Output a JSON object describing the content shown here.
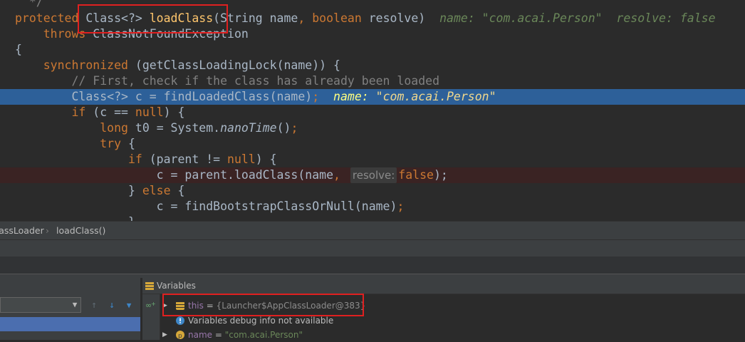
{
  "editor": {
    "lines": [
      {
        "parts": [
          {
            "t": "  */",
            "c": "cm"
          }
        ]
      },
      {
        "parts": [
          {
            "t": "protected ",
            "c": "kw"
          },
          {
            "t": "Class<?> ",
            "c": ""
          },
          {
            "t": "loadClass",
            "c": "fn"
          },
          {
            "t": "(String name",
            "c": ""
          },
          {
            "t": ", ",
            "c": "kw"
          },
          {
            "t": "boolean ",
            "c": "kw"
          },
          {
            "t": "resolve)  ",
            "c": ""
          },
          {
            "t": "name: \"com.acai.Person\"  resolve: false",
            "c": "inl"
          }
        ]
      },
      {
        "parts": [
          {
            "t": "    throws ",
            "c": "kw"
          },
          {
            "t": "ClassNotFoundException",
            "c": ""
          }
        ]
      },
      {
        "parts": [
          {
            "t": "{",
            "c": ""
          }
        ]
      },
      {
        "parts": [
          {
            "t": "    synchronized ",
            "c": "kw"
          },
          {
            "t": "(getClassLoadingLock(name)) {",
            "c": ""
          }
        ]
      },
      {
        "parts": [
          {
            "t": "        // First, check if the class has already been loaded",
            "c": "cm"
          }
        ]
      },
      {
        "hl": true,
        "parts": [
          {
            "t": "        Class<?> c = findLoadedClass(name)",
            "c": ""
          },
          {
            "t": ";  ",
            "c": "kw"
          },
          {
            "t": "name: ",
            "c": "inl-hl"
          },
          {
            "t": "\"com.acai.Person\"",
            "c": "inl-hl-v"
          }
        ]
      },
      {
        "parts": [
          {
            "t": "        if ",
            "c": "kw"
          },
          {
            "t": "(c == ",
            "c": ""
          },
          {
            "t": "null",
            "c": "kw"
          },
          {
            "t": ") {",
            "c": ""
          }
        ]
      },
      {
        "parts": [
          {
            "t": "            long ",
            "c": "kw"
          },
          {
            "t": "t0 = System.",
            "c": ""
          },
          {
            "t": "nanoTime",
            "c": "it"
          },
          {
            "t": "()",
            "c": ""
          },
          {
            "t": ";",
            "c": "kw"
          }
        ]
      },
      {
        "parts": [
          {
            "t": "            try ",
            "c": "kw"
          },
          {
            "t": "{",
            "c": ""
          }
        ]
      },
      {
        "parts": [
          {
            "t": "                if ",
            "c": "kw"
          },
          {
            "t": "(parent != ",
            "c": ""
          },
          {
            "t": "null",
            "c": "kw"
          },
          {
            "t": ") {",
            "c": ""
          }
        ]
      },
      {
        "err": true,
        "parts": [
          {
            "t": "                    c = parent.loadClass(name",
            "c": ""
          },
          {
            "t": ", ",
            "c": "kw"
          },
          {
            "t": "resolve:",
            "c": "badge"
          },
          {
            "t": "false",
            "c": "kw"
          },
          {
            "t": ");",
            "c": ""
          }
        ]
      },
      {
        "parts": [
          {
            "t": "                } ",
            "c": ""
          },
          {
            "t": "else ",
            "c": "kw"
          },
          {
            "t": "{",
            "c": ""
          }
        ]
      },
      {
        "parts": [
          {
            "t": "                    c = findBootstrapClassOrNull(name)",
            "c": ""
          },
          {
            "t": ";",
            "c": "kw"
          }
        ]
      },
      {
        "parts": [
          {
            "t": "                }",
            "c": ""
          }
        ]
      }
    ]
  },
  "breadcrumb": {
    "items": [
      "ClassLoader",
      "loadClass()"
    ],
    "separator": "›"
  },
  "variables_panel": {
    "title": "Variables",
    "rows": [
      {
        "expand": "▶",
        "icon": "field-icon",
        "icon_color": "#d6a83a",
        "name": "this",
        "equals": " = ",
        "value": "{Launcher$AppClassLoader@383}"
      },
      {
        "expand": "",
        "icon": "info-icon",
        "icon_color": "#3e86c7",
        "name": "",
        "equals": "",
        "value": "Variables debug info not available"
      },
      {
        "expand": "▶",
        "icon": "parameter-icon",
        "icon_color": "#d6a83a",
        "name": "name",
        "equals": " = ",
        "value": "\"com.acai.Person\""
      }
    ]
  },
  "frames_panel": {
    "dropdown_arrow": "▼",
    "toolbar": [
      {
        "name": "up-arrow-icon",
        "glyph": "↑",
        "color": "#5f6b73"
      },
      {
        "name": "down-arrow-icon",
        "glyph": "↓",
        "color": "#3e86c7"
      },
      {
        "name": "filter-icon",
        "glyph": "▼",
        "color": "#3e86c7"
      }
    ]
  }
}
